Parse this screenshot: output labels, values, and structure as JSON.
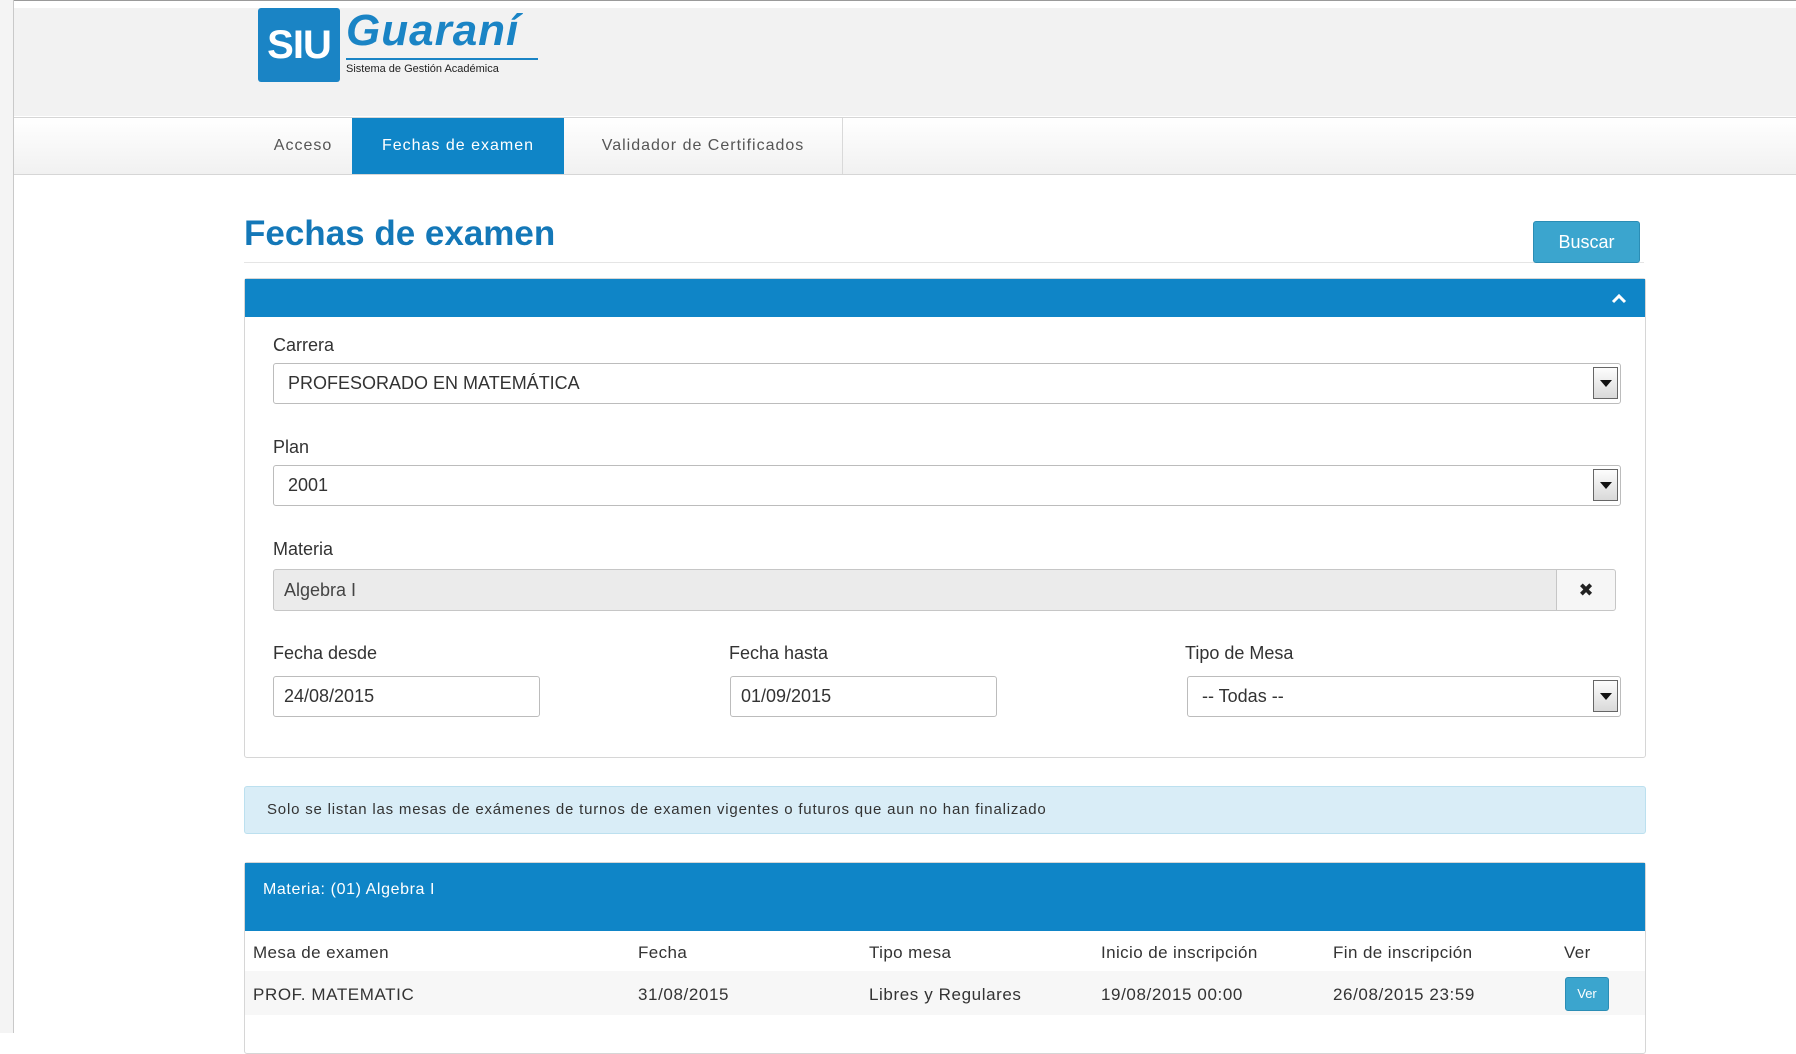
{
  "brand": {
    "logo_mark": "SIU",
    "name": "Guaraní",
    "subtitle": "Sistema de Gestión Académica",
    "color": "#1a84c5"
  },
  "nav": {
    "tabs": [
      {
        "label": "Acceso",
        "active": false
      },
      {
        "label": "Fechas de examen",
        "active": true
      },
      {
        "label": "Validador de Certificados",
        "active": false
      }
    ],
    "active_color": "#0f85c7"
  },
  "page": {
    "title": "Fechas de examen",
    "search_label": "Buscar"
  },
  "filters": {
    "collapse_icon": "chevron-up-icon",
    "carrera": {
      "label": "Carrera",
      "value": "PROFESORADO EN MATEMÁTICA"
    },
    "plan": {
      "label": "Plan",
      "value": "2001"
    },
    "materia": {
      "label": "Materia",
      "value": "Algebra I",
      "clear_icon": "close-icon",
      "clear_glyph": "✖"
    },
    "fecha_desde": {
      "label": "Fecha desde",
      "value": "24/08/2015"
    },
    "fecha_hasta": {
      "label": "Fecha hasta",
      "value": "01/09/2015"
    },
    "tipo_mesa": {
      "label": "Tipo de Mesa",
      "value": "-- Todas --"
    }
  },
  "info": {
    "message": "Solo se listan las mesas de exámenes de turnos de examen vigentes o futuros que aun no han finalizado"
  },
  "results": {
    "group_title": "Materia: (01) Algebra I",
    "columns": [
      "Mesa de examen",
      "Fecha",
      "Tipo mesa",
      "Inicio de inscripción",
      "Fin de inscripción",
      "Ver"
    ],
    "rows": [
      {
        "mesa": "PROF. MATEMATIC",
        "fecha": "31/08/2015",
        "tipo": "Libres y Regulares",
        "inicio": "19/08/2015 00:00",
        "fin": "26/08/2015 23:59",
        "ver_label": "Ver"
      }
    ]
  }
}
